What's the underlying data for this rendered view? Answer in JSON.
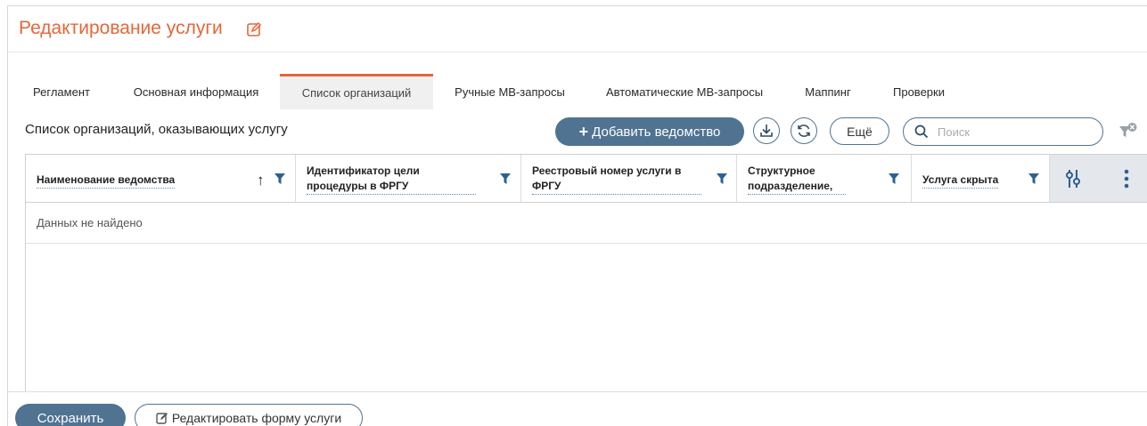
{
  "page": {
    "title": "Редактирование услуги"
  },
  "tabs": [
    {
      "label": "Регламент",
      "active": false
    },
    {
      "label": "Основная информация",
      "active": false
    },
    {
      "label": "Список организаций",
      "active": true
    },
    {
      "label": "Ручные МВ-запросы",
      "active": false
    },
    {
      "label": "Автоматические МВ-запросы",
      "active": false
    },
    {
      "label": "Маппинг",
      "active": false
    },
    {
      "label": "Проверки",
      "active": false
    }
  ],
  "section": {
    "title": "Список организаций, оказывающих услугу"
  },
  "toolbar": {
    "add_label": "Добавить ведомство",
    "add_icon": "plus-icon",
    "download_icon": "download-icon",
    "refresh_icon": "refresh-icon",
    "more_label": "Ещё",
    "search_placeholder": "Поиск",
    "search_icon": "search-icon",
    "filter_clear_icon": "filter-clear-icon"
  },
  "grid": {
    "columns": [
      {
        "label": "Наименование ведомства",
        "sorted": "asc"
      },
      {
        "label": "Идентификатор цели процедуры в ФРГУ"
      },
      {
        "label": "Реестровый номер услуги в ФРГУ"
      },
      {
        "label": "Структурное подразделение,"
      },
      {
        "label": "Услуга скрыта"
      }
    ],
    "empty_text": "Данных не найдено",
    "sort_arrow": "↑"
  },
  "footer": {
    "save_label": "Сохранить",
    "edit_form_label": "Редактировать форму услуги"
  },
  "colors": {
    "accent": "#e4673a",
    "primary": "#4f7391",
    "filter": "#2d5f93"
  }
}
